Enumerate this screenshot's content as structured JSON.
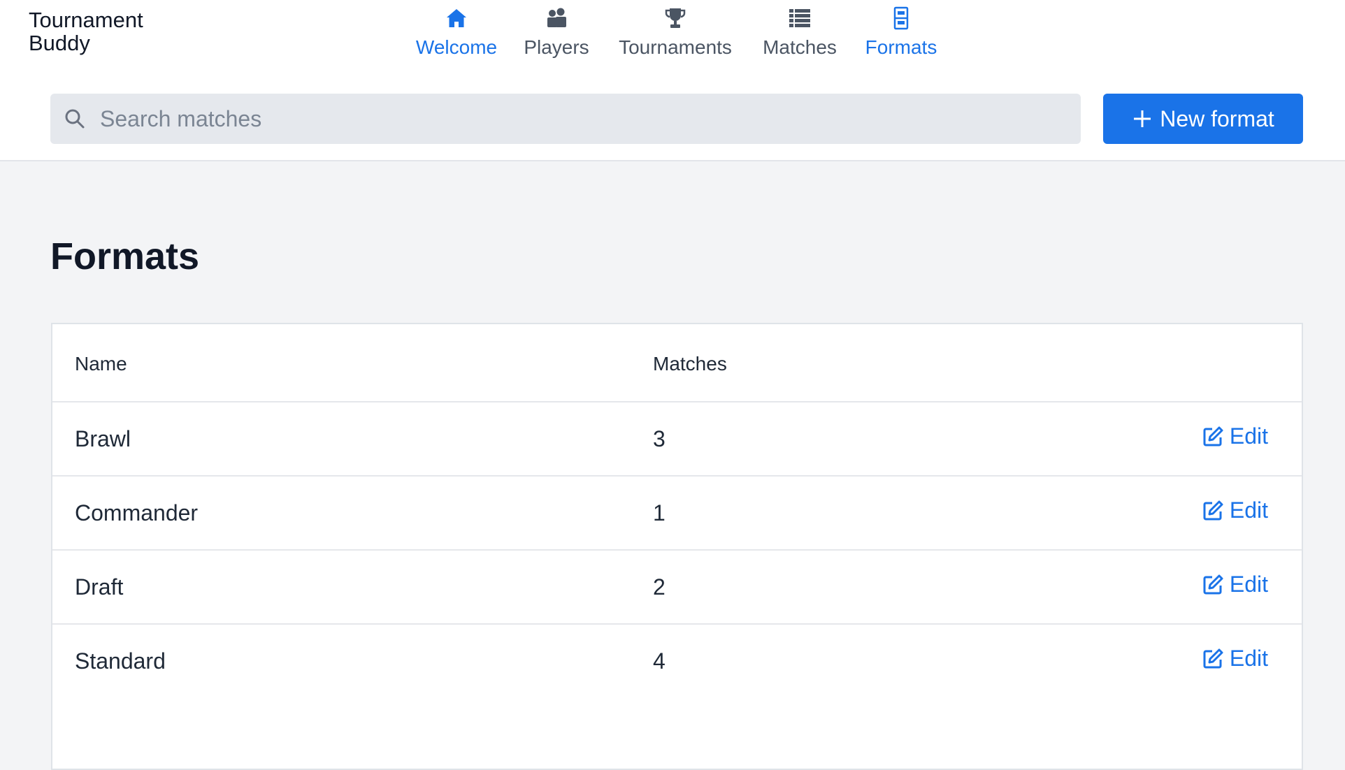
{
  "app": {
    "title_line1": "Tournament",
    "title_line2": "Buddy"
  },
  "nav": {
    "items": [
      {
        "label": "Welcome",
        "icon": "home-icon",
        "active": true
      },
      {
        "label": "Players",
        "icon": "users-icon",
        "active": false
      },
      {
        "label": "Tournaments",
        "icon": "trophy-icon",
        "active": false
      },
      {
        "label": "Matches",
        "icon": "list-icon",
        "active": false
      },
      {
        "label": "Formats",
        "icon": "cabinet-icon",
        "active": true
      }
    ]
  },
  "search": {
    "placeholder": "Search matches",
    "value": ""
  },
  "toolbar": {
    "new_label": "New format"
  },
  "page": {
    "title": "Formats"
  },
  "table": {
    "columns": [
      "Name",
      "Matches"
    ],
    "rows": [
      {
        "name": "Brawl",
        "matches": "3",
        "action": "Edit"
      },
      {
        "name": "Commander",
        "matches": "1",
        "action": "Edit"
      },
      {
        "name": "Draft",
        "matches": "2",
        "action": "Edit"
      },
      {
        "name": "Standard",
        "matches": "4",
        "action": "Edit"
      }
    ]
  },
  "colors": {
    "accent": "#1a73e8",
    "background": "#f3f4f6",
    "search_bg": "#e5e8ed"
  }
}
